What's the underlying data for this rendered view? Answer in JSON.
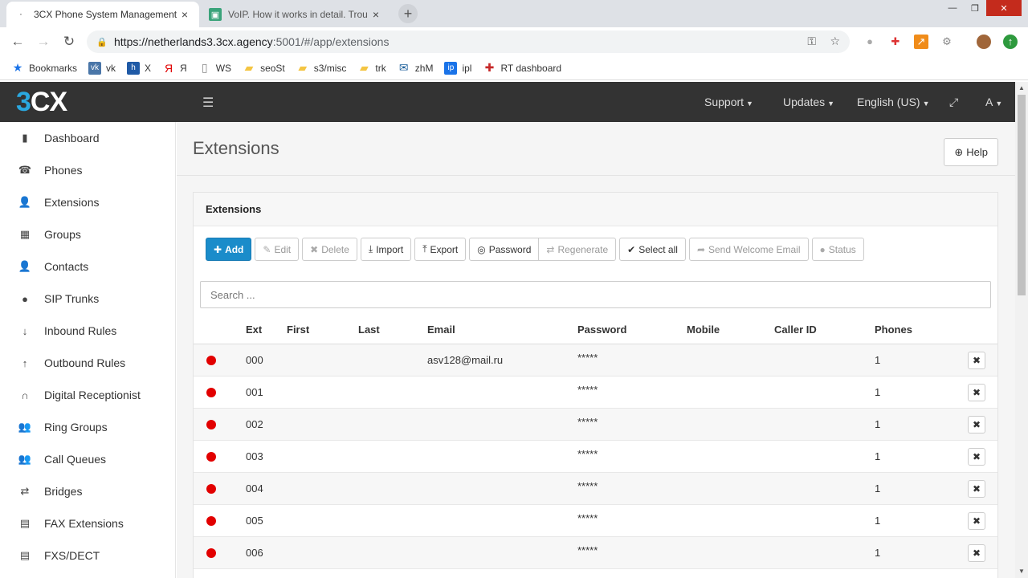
{
  "browser": {
    "tabs": [
      {
        "title": "3CX Phone System Management",
        "close": "×"
      },
      {
        "title": "VoIP. How it works in detail. Trou",
        "close": "×"
      }
    ],
    "new_tab": "+",
    "url_main": "https://netherlands3.3cx.agency",
    "url_rest": ":5001/#/app/extensions",
    "bookmarks": [
      {
        "label": "Bookmarks",
        "icon": "star-icon",
        "color": "#1a73e8"
      },
      {
        "label": "vk",
        "icon": "vk-icon",
        "color": "#4a76a8"
      },
      {
        "label": "X",
        "icon": "h-icon",
        "color": "#1f5aa6"
      },
      {
        "label": "Я",
        "icon": "yandex-icon",
        "color": "#e00000"
      },
      {
        "label": "WS",
        "icon": "page-icon",
        "color": "#888888"
      },
      {
        "label": "seoSt",
        "icon": "folder-icon",
        "color": "#f4c542"
      },
      {
        "label": "s3/misc",
        "icon": "folder-icon",
        "color": "#f4c542"
      },
      {
        "label": "trk",
        "icon": "folder-icon",
        "color": "#f4c542"
      },
      {
        "label": "zhM",
        "icon": "mail-icon",
        "color": "#1b5e9a"
      },
      {
        "label": "ipl",
        "icon": "ip-icon",
        "color": "#1a73e8"
      },
      {
        "label": "RT dashboard",
        "icon": "rt-icon",
        "color": "#c62828"
      }
    ]
  },
  "header": {
    "menus": [
      {
        "label": "Support"
      },
      {
        "label": "Updates"
      },
      {
        "label": "English (US)"
      },
      {
        "label": "A"
      }
    ]
  },
  "sidebar": {
    "items": [
      {
        "label": "Dashboard",
        "icon": "bar-chart-icon"
      },
      {
        "label": "Phones",
        "icon": "phone-icon"
      },
      {
        "label": "Extensions",
        "icon": "user-icon"
      },
      {
        "label": "Groups",
        "icon": "grid-icon"
      },
      {
        "label": "Contacts",
        "icon": "user-icon"
      },
      {
        "label": "SIP Trunks",
        "icon": "globe-icon"
      },
      {
        "label": "Inbound Rules",
        "icon": "arrow-down-icon"
      },
      {
        "label": "Outbound Rules",
        "icon": "arrow-up-icon"
      },
      {
        "label": "Digital Receptionist",
        "icon": "headset-icon"
      },
      {
        "label": "Ring Groups",
        "icon": "users-icon"
      },
      {
        "label": "Call Queues",
        "icon": "users-icon"
      },
      {
        "label": "Bridges",
        "icon": "exchange-icon"
      },
      {
        "label": "FAX Extensions",
        "icon": "fax-icon"
      },
      {
        "label": "FXS/DECT",
        "icon": "fax-icon"
      }
    ]
  },
  "main": {
    "title": "Extensions",
    "help_label": "Help",
    "panel_title": "Extensions",
    "buttons": {
      "add": "Add",
      "edit": "Edit",
      "delete": "Delete",
      "import": "Import",
      "export": "Export",
      "password": "Password",
      "regenerate": "Regenerate",
      "select_all": "Select all",
      "send_welcome": "Send Welcome Email",
      "status": "Status"
    },
    "search_placeholder": "Search ...",
    "columns": {
      "ext": "Ext",
      "first": "First",
      "last": "Last",
      "email": "Email",
      "password": "Password",
      "mobile": "Mobile",
      "caller_id": "Caller ID",
      "phones": "Phones"
    },
    "rows": [
      {
        "ext": "000",
        "first": "",
        "last": "",
        "email": "asv128@mail.ru",
        "password": "*****",
        "mobile": "",
        "caller_id": "",
        "phones": "1",
        "status": "offline"
      },
      {
        "ext": "001",
        "first": "",
        "last": "",
        "email": "",
        "password": "*****",
        "mobile": "",
        "caller_id": "",
        "phones": "1",
        "status": "offline"
      },
      {
        "ext": "002",
        "first": "",
        "last": "",
        "email": "",
        "password": "*****",
        "mobile": "",
        "caller_id": "",
        "phones": "1",
        "status": "offline"
      },
      {
        "ext": "003",
        "first": "",
        "last": "",
        "email": "",
        "password": "*****",
        "mobile": "",
        "caller_id": "",
        "phones": "1",
        "status": "offline"
      },
      {
        "ext": "004",
        "first": "",
        "last": "",
        "email": "",
        "password": "*****",
        "mobile": "",
        "caller_id": "",
        "phones": "1",
        "status": "offline"
      },
      {
        "ext": "005",
        "first": "",
        "last": "",
        "email": "",
        "password": "*****",
        "mobile": "",
        "caller_id": "",
        "phones": "1",
        "status": "offline"
      },
      {
        "ext": "006",
        "first": "",
        "last": "",
        "email": "",
        "password": "*****",
        "mobile": "",
        "caller_id": "",
        "phones": "1",
        "status": "offline"
      }
    ],
    "status_color": "#e20000",
    "accent": "#1a8cca"
  }
}
